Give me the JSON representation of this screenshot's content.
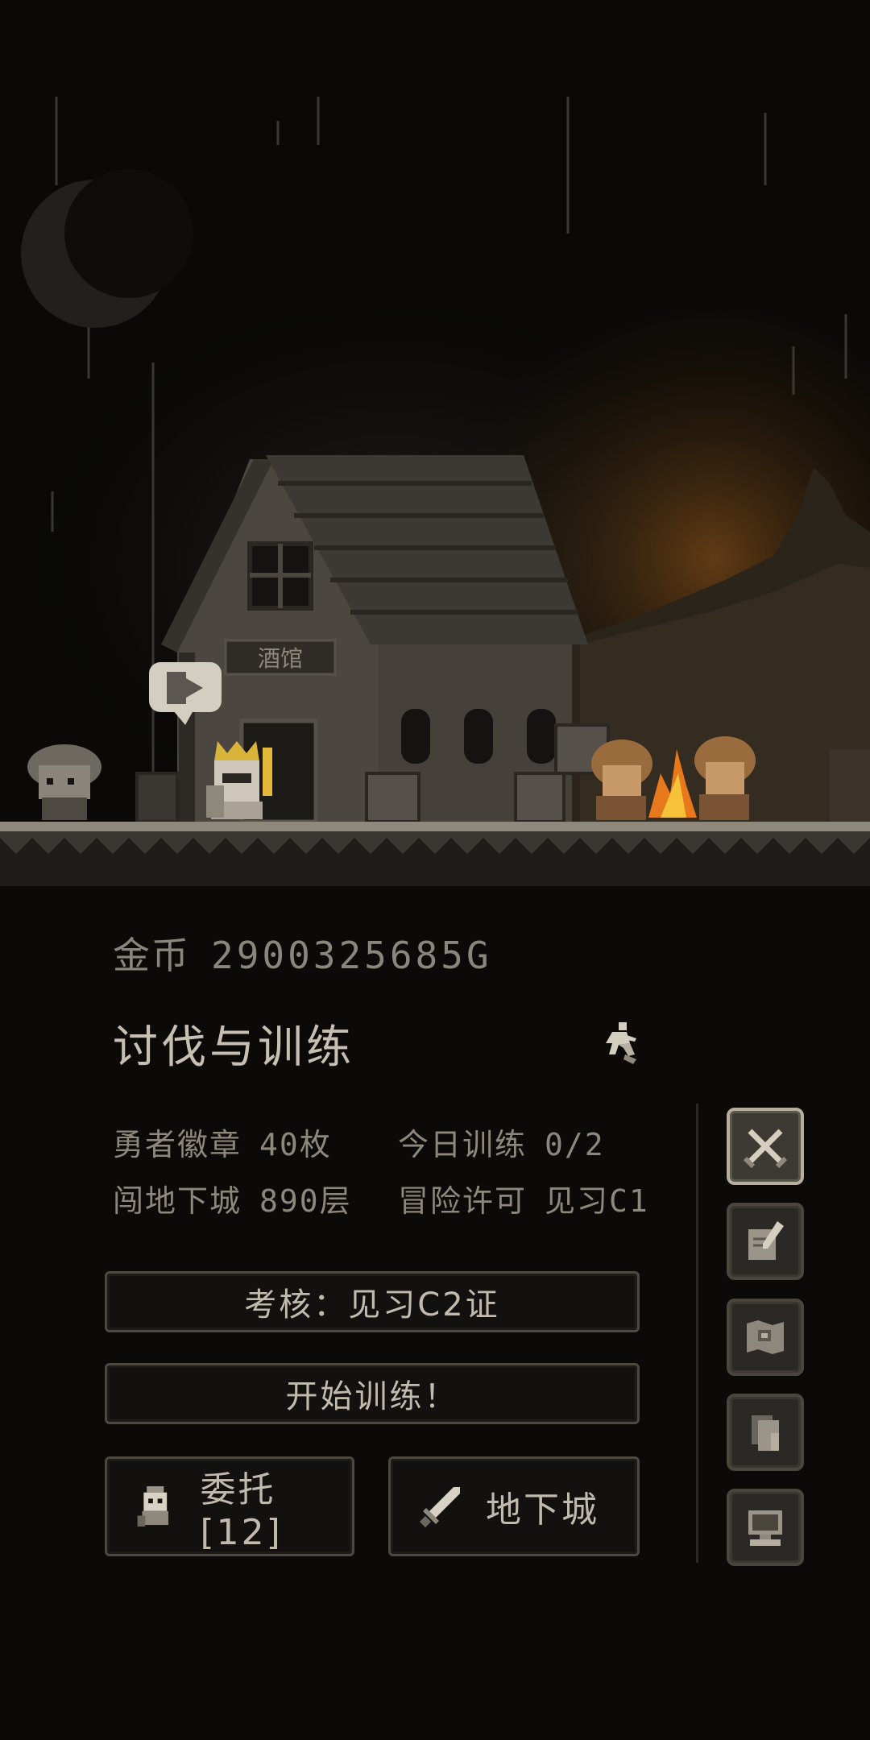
{
  "status": {
    "gold_label": "金币",
    "gold_value": "2900325685G"
  },
  "panel": {
    "title": "讨伐与训练",
    "stats": [
      {
        "label": "勇者徽章",
        "value": "40枚"
      },
      {
        "label": "今日训练",
        "value": "0/2"
      },
      {
        "label": "闯地下城",
        "value": "890层"
      },
      {
        "label": "冒险许可",
        "value": "见习C1"
      }
    ],
    "exam_button": "考核：见习C2证",
    "train_button": "开始训练！",
    "commission_button": "委托[12]",
    "dungeon_button": "地下城"
  },
  "scene": {
    "tavern_sign": "酒馆"
  },
  "side_menu": [
    {
      "icon": "crossed-swords-icon",
      "active": true
    },
    {
      "icon": "quill-scroll-icon",
      "active": false
    },
    {
      "icon": "map-icon",
      "active": false
    },
    {
      "icon": "documents-icon",
      "active": false
    },
    {
      "icon": "computer-icon",
      "active": false
    }
  ],
  "colors": {
    "background": "#0b0a08",
    "text": "#bdb6a8",
    "muted_text": "#8d877c",
    "fire": "#e8781c"
  }
}
